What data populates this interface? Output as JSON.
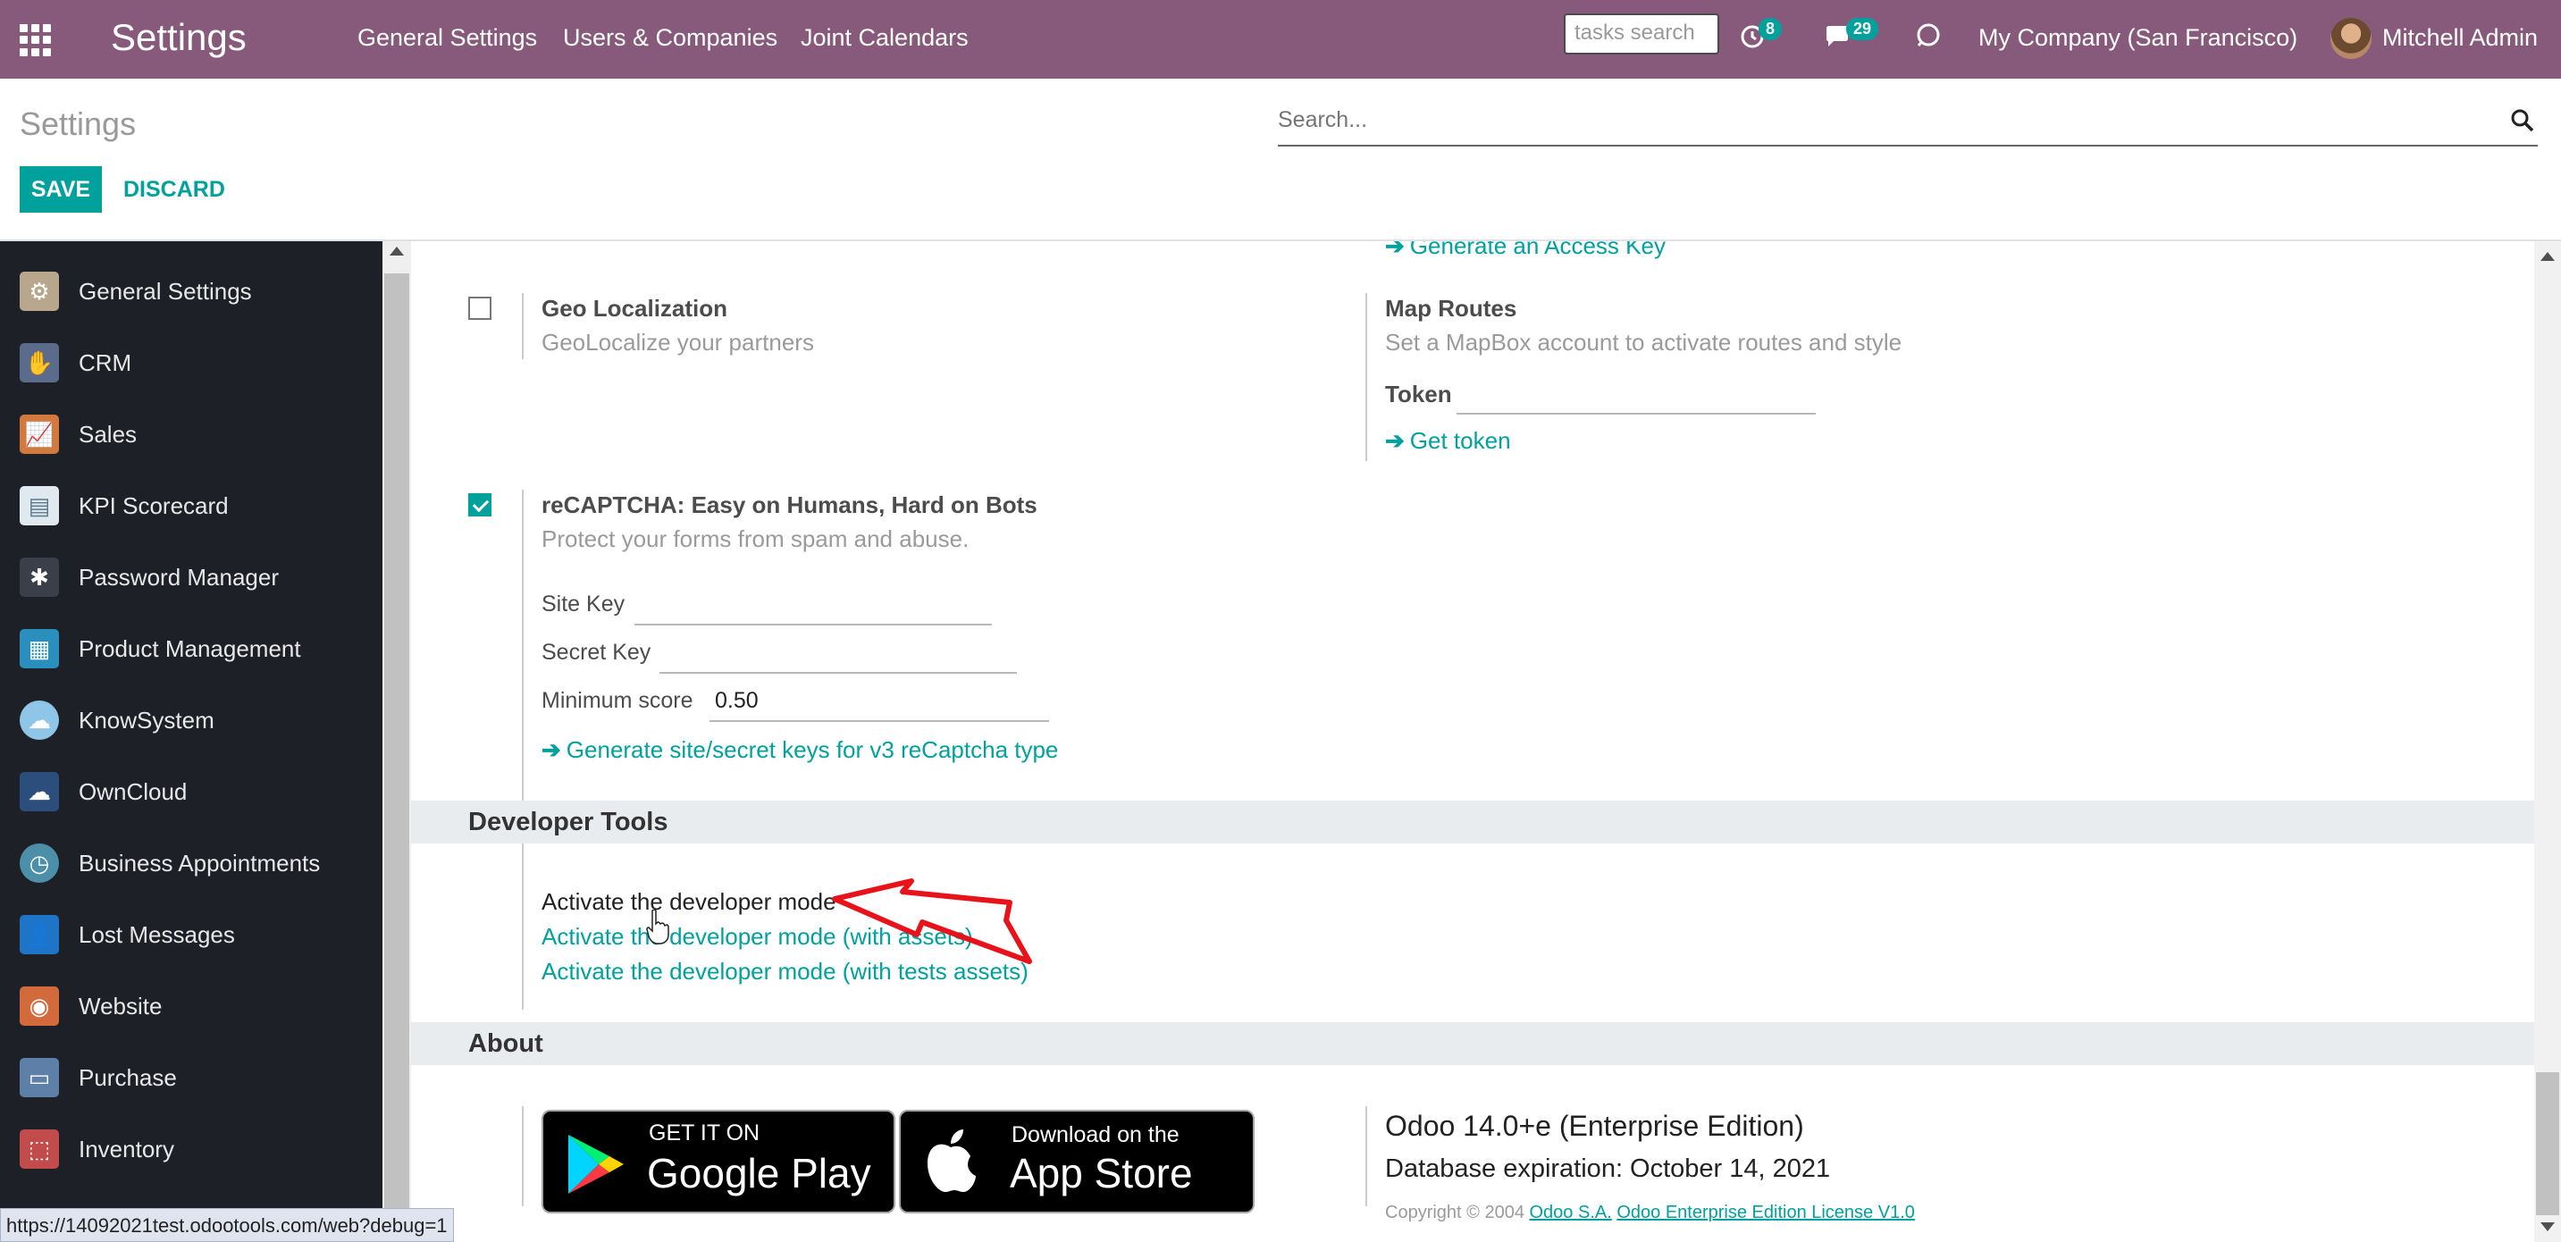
{
  "navbar": {
    "app_title": "Settings",
    "menu": [
      "General Settings",
      "Users & Companies",
      "Joint Calendars"
    ],
    "tasks_search_placeholder": "tasks search",
    "activity_count": "8",
    "messages_count": "29",
    "company": "My Company (San Francisco)",
    "user": "Mitchell Admin"
  },
  "control_panel": {
    "breadcrumb": "Settings",
    "search_placeholder": "Search...",
    "save_label": "SAVE",
    "discard_label": "DISCARD"
  },
  "sidebar": {
    "items": [
      {
        "label": "General Settings",
        "icon": "gear-icon",
        "color": "#b9a78d"
      },
      {
        "label": "CRM",
        "icon": "handshake-icon",
        "color": "#5b6b8c"
      },
      {
        "label": "Sales",
        "icon": "chart-icon",
        "color": "#d27a3e"
      },
      {
        "label": "KPI Scorecard",
        "icon": "scorecard-icon",
        "color": "#dfe9ef"
      },
      {
        "label": "Password Manager",
        "icon": "password-icon",
        "color": "#3a3f4a"
      },
      {
        "label": "Product Management",
        "icon": "product-icon",
        "color": "#2a8fbd"
      },
      {
        "label": "KnowSystem",
        "icon": "brain-icon",
        "color": "#8fc5e6"
      },
      {
        "label": "OwnCloud",
        "icon": "cloud-icon",
        "color": "#2c4e7d"
      },
      {
        "label": "Business Appointments",
        "icon": "clock-icon",
        "color": "#4b8fa8"
      },
      {
        "label": "Lost Messages",
        "icon": "user-question-icon",
        "color": "#1e74c7"
      },
      {
        "label": "Website",
        "icon": "globe-icon",
        "color": "#d26a3c"
      },
      {
        "label": "Purchase",
        "icon": "card-icon",
        "color": "#5d7fa8"
      },
      {
        "label": "Inventory",
        "icon": "box-icon",
        "color": "#c24c4c"
      }
    ]
  },
  "content": {
    "generate_access_key": "Generate an Access Key",
    "geo": {
      "title": "Geo Localization",
      "description": "GeoLocalize your partners",
      "checked": false
    },
    "map_routes": {
      "title": "Map Routes",
      "description": "Set a MapBox account to activate routes and style",
      "token_label": "Token",
      "token_value": "",
      "get_token": "Get token"
    },
    "recaptcha": {
      "title": "reCAPTCHA: Easy on Humans, Hard on Bots",
      "description": "Protect your forms from spam and abuse.",
      "checked": true,
      "site_key_label": "Site Key",
      "site_key_value": "",
      "secret_key_label": "Secret Key",
      "secret_key_value": "",
      "min_score_label": "Minimum score",
      "min_score_value": "0.50",
      "generate_link": "Generate site/secret keys for v3 reCaptcha type"
    },
    "developer": {
      "header": "Developer Tools",
      "activate": "Activate the developer mode",
      "activate_assets": "Activate the developer mode (with assets)",
      "activate_tests": "Activate the developer mode (with tests assets)"
    },
    "about": {
      "header": "About",
      "google_small": "GET IT ON",
      "google_big": "Google Play",
      "apple_small": "Download on the",
      "apple_big": "App Store",
      "version": "Odoo 14.0+e (Enterprise Edition)",
      "expiration": "Database expiration: October 14, 2021",
      "copyright": "Copyright © 2004",
      "company_link": "Odoo S.A.",
      "license_link": "Odoo Enterprise Edition License V1.0"
    }
  },
  "status_url": "https://14092021test.odootools.com/web?debug=1",
  "colors": {
    "navbar": "#875a7b",
    "accent": "#00a09d",
    "sidebar": "#1d2026",
    "annotation_arrow": "#e8121b"
  }
}
